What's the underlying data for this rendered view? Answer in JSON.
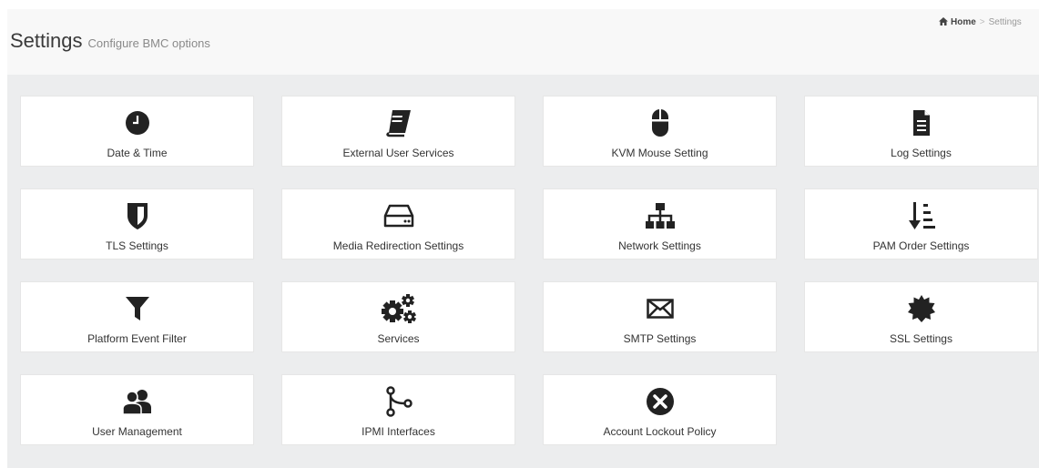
{
  "header": {
    "title": "Settings",
    "subtitle": "Configure BMC options",
    "breadcrumb": {
      "home": "Home",
      "separator": ">",
      "current": "Settings"
    }
  },
  "tiles": [
    {
      "label": "Date & Time",
      "icon": "clock-icon"
    },
    {
      "label": "External User Services",
      "icon": "book-icon"
    },
    {
      "label": "KVM Mouse Setting",
      "icon": "mouse-icon"
    },
    {
      "label": "Log Settings",
      "icon": "file-text-icon"
    },
    {
      "label": "TLS Settings",
      "icon": "shield-icon"
    },
    {
      "label": "Media Redirection Settings",
      "icon": "hard-drive-icon"
    },
    {
      "label": "Network Settings",
      "icon": "sitemap-icon"
    },
    {
      "label": "PAM Order Settings",
      "icon": "sort-order-icon"
    },
    {
      "label": "Platform Event Filter",
      "icon": "filter-icon"
    },
    {
      "label": "Services",
      "icon": "cogs-icon"
    },
    {
      "label": "SMTP Settings",
      "icon": "envelope-icon"
    },
    {
      "label": "SSL Settings",
      "icon": "certificate-icon"
    },
    {
      "label": "User Management",
      "icon": "users-icon"
    },
    {
      "label": "IPMI Interfaces",
      "icon": "branch-icon"
    },
    {
      "label": "Account Lockout Policy",
      "icon": "close-circle-icon"
    }
  ]
}
